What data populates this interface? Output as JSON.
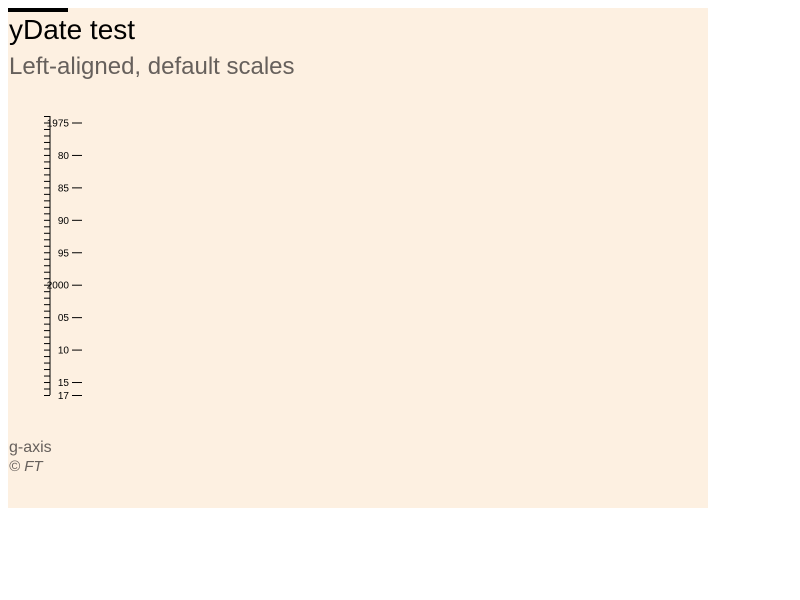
{
  "header": {
    "title": "yDate test",
    "subtitle": "Left-aligned, default scales"
  },
  "footer": {
    "source": "g-axis",
    "credit": "© FT"
  },
  "colors": {
    "background": "#fdf0e1",
    "accent": "#000000",
    "muted_text": "#66605c"
  },
  "chart_data": {
    "type": "axis",
    "axis": "y",
    "scale": "time",
    "domain": [
      "1974-01-01",
      "2017-01-01"
    ],
    "major_ticks": [
      {
        "year": 1975,
        "label": "1975"
      },
      {
        "year": 1980,
        "label": "80"
      },
      {
        "year": 1985,
        "label": "85"
      },
      {
        "year": 1990,
        "label": "90"
      },
      {
        "year": 1995,
        "label": "95"
      },
      {
        "year": 2000,
        "label": "2000"
      },
      {
        "year": 2005,
        "label": "05"
      },
      {
        "year": 2010,
        "label": "10"
      },
      {
        "year": 2015,
        "label": "15"
      },
      {
        "year": 2017,
        "label": "17"
      }
    ],
    "minor_tick_interval": "1 year",
    "alignment": "left"
  }
}
